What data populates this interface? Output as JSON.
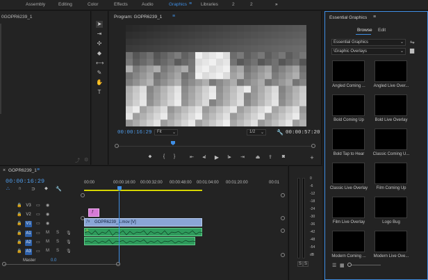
{
  "workspaces": [
    {
      "label": "Assembly"
    },
    {
      "label": "Editing"
    },
    {
      "label": "Color"
    },
    {
      "label": "Effects"
    },
    {
      "label": "Audio"
    },
    {
      "label": "Graphics",
      "active": true
    },
    {
      "label": "Libraries"
    },
    {
      "label": "2"
    },
    {
      "label": "2"
    }
  ],
  "overflow_icon": "»",
  "source_panel": {
    "title": "0GOPR6239_1"
  },
  "program": {
    "title": "Program: GOPR6239_1",
    "current_tc": "00:00:16:29",
    "fit": "Fit",
    "resolution": "1/2",
    "duration_tc": "00:00:57:20"
  },
  "timeline": {
    "sequence_title": "GOPR6239_1",
    "current_tc": "00:00:16:29",
    "ruler": [
      "00:00",
      "00:00:16:00",
      "00:00:32:00",
      "00:00:48:00",
      "00:01:04:00",
      "00:01:20:00",
      "00:01"
    ],
    "tracks": [
      {
        "name": "V3",
        "highlight": false
      },
      {
        "name": "V2",
        "highlight": false
      },
      {
        "name": "V1",
        "highlight": true
      },
      {
        "name": "A1",
        "highlight": true
      },
      {
        "name": "A2",
        "highlight": true
      },
      {
        "name": "A3",
        "highlight": true
      }
    ],
    "master_label": "Master",
    "master_value": "0.0",
    "clip_name": "GOPR6239_1.mov [V]",
    "meter_labels": [
      "0",
      "-6",
      "-12",
      "-18",
      "-24",
      "-30",
      "-36",
      "-42",
      "-48",
      "-54",
      "dB"
    ],
    "solo_labels": [
      "S",
      "S"
    ]
  },
  "essential_graphics": {
    "title": "Essential Graphics",
    "tabs": [
      "Browse",
      "Edit"
    ],
    "library": "Essential Graphics",
    "folder": "\\Graphic Overlays",
    "templates": [
      {
        "label": "Angled Coming ..."
      },
      {
        "label": "Angled Live Over..."
      },
      {
        "label": "Bold Coming Up"
      },
      {
        "label": "Bold Live Overlay"
      },
      {
        "label": "Bold Tap to Hear"
      },
      {
        "label": "Classic Coming U..."
      },
      {
        "label": "Classic Live Overlay"
      },
      {
        "label": "Film Coming Up"
      },
      {
        "label": "Film Live Overlay"
      },
      {
        "label": "Logo Bug"
      },
      {
        "label": "Modern Coming ..."
      },
      {
        "label": "Modern Live Ove..."
      }
    ]
  },
  "colors": {
    "accent": "#3f8fe6",
    "video_clip": "#8aa6d6",
    "audio_clip": "#2f9b5c",
    "graphic_clip": "#d67ad6",
    "playhead": "#3f8fe6"
  }
}
